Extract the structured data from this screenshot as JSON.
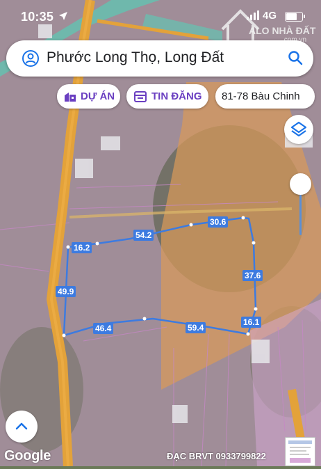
{
  "status_bar": {
    "time": "10:35",
    "network": "4G"
  },
  "watermark": {
    "text": "ALO NHÀ ĐẤT",
    "sub": ".com.vn"
  },
  "search": {
    "query": "Phước Long Thọ, Long Đất"
  },
  "chips": {
    "project": "DỰ ÁN",
    "listing": "TIN ĐĂNG",
    "address": "81-78 Bàu Chinh"
  },
  "dimensions": {
    "d1": "16.2",
    "d2": "54.2",
    "d3": "30.6",
    "d4": "37.6",
    "d5": "49.9",
    "d6": "16.1",
    "d7": "46.4",
    "d8": "59.4"
  },
  "footer": {
    "brand": "Google",
    "contact": "ĐẠC BRVT 0933799822"
  },
  "colors": {
    "accent": "#6a3fc1",
    "boundary": "#3d7be0",
    "road": "#e3a23a",
    "zone_pink": "#d9a6d6",
    "zone_orange": "#e2a067"
  },
  "icons": [
    "location-arrow-icon",
    "person-icon",
    "search-icon",
    "building-icon",
    "list-icon",
    "layers-icon",
    "chevron-up-icon"
  ]
}
